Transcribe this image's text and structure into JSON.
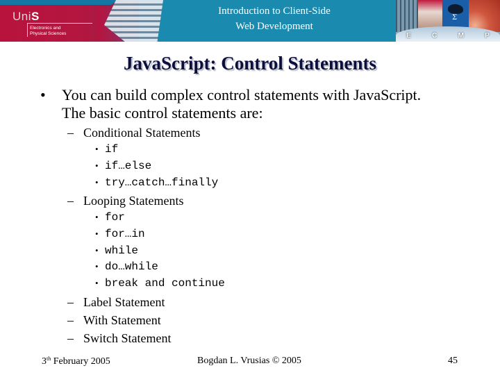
{
  "header": {
    "logo_prefix": "Uni",
    "logo_suffix": "S",
    "department_line1": "Electronics and",
    "department_line2": "Physical Sciences",
    "course_title_line1": "Introduction to Client-Side",
    "course_title_line2": "Web Development",
    "ecmp_letters": [
      "E",
      "C",
      "M",
      "P"
    ],
    "colors": {
      "banner_blue": "#1a8aae",
      "unis_red": "#b8133d"
    }
  },
  "slide": {
    "title": "JavaScript: Control Statements",
    "title_color": "#0c0f3c",
    "bullet_symbol": "•",
    "dash_symbol": "–",
    "intro_line1": "You can build complex control statements with JavaScript.",
    "intro_line2": "The basic control statements are:",
    "groups": [
      {
        "label": "Conditional Statements",
        "items": [
          "if",
          "if…else",
          "try…catch…finally"
        ]
      },
      {
        "label": "Looping Statements",
        "items": [
          "for",
          "for…in",
          "while",
          "do…while",
          "break and continue"
        ]
      },
      {
        "label": "Label Statement",
        "items": []
      },
      {
        "label": "With Statement",
        "items": []
      },
      {
        "label": "Switch Statement",
        "items": []
      }
    ]
  },
  "footer": {
    "date_day": "3",
    "date_suffix": "th",
    "date_rest": " February 2005",
    "author": "Bogdan L. Vrusias © 2005",
    "page_number": "45"
  }
}
